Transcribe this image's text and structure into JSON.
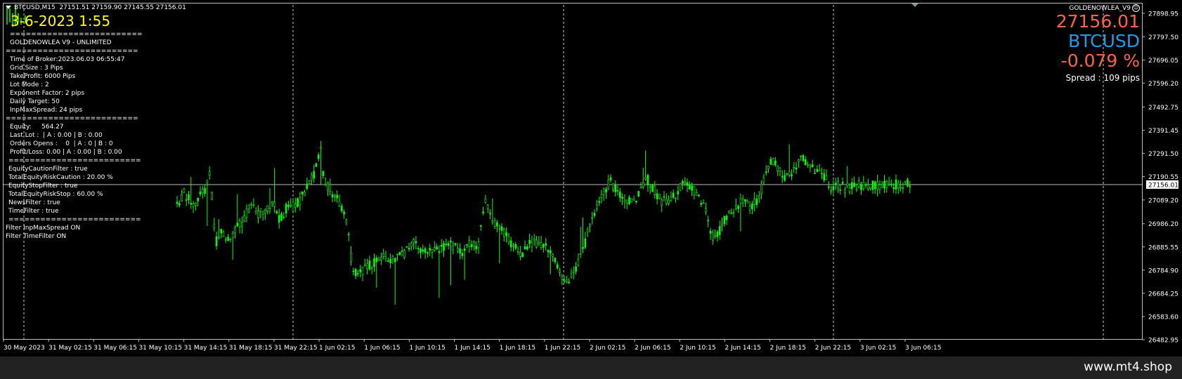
{
  "window": {
    "symbol_bar": "BTCUSD,M15  27151.51 27159.90 27145.55 27156.01",
    "datetime_overlay": "3-6-2023 1:55"
  },
  "ea_panel": {
    "sep": "=========================",
    "title": "GOLDENOWLEA V9 - UNLIMITED",
    "broker_time": "Time of Broker:2023.06.03 06:55:47",
    "grid_size": "Grid Size : 3 Pips",
    "take_profit": "TakeProfit: 6000 Pips",
    "lot_mode": "Lot Mode : 2",
    "exponent_factor": "Exponent Factor: 2 pips",
    "daily_target": "Daily Target: 50",
    "inp_max_spread": "InpMaxSpread: 24 pips",
    "equity": "Equity:     564.27",
    "last_lot": "Last Lot :  | A : 0.00 | B : 0.00",
    "orders_opens": "Orders Opens :    0  | A : 0 | B : 0",
    "profit_loss": "Profit/Loss: 0.00 | A : 0.00 | B : 0.00",
    "equity_caution_filter": "EquityCautionFilter : true",
    "total_equity_risk_caution": "TotalEquityRiskCaution : 20.00 %",
    "equity_stop_filter": "EquityStopFilter : true",
    "total_equity_risk_stop": "TotalEquityRiskStop : 60.00 %",
    "news_filter": "NewsFilter : true",
    "time_filter": "TimeFilter : true",
    "filter_spread_status": "Filter InpMaxSpread ON",
    "filter_time_status": "Filter TimeFilter ON"
  },
  "right_panel": {
    "ea_name": "GOLDENOWLEA_V9",
    "price": "27156.01",
    "symbol": "BTCUSD",
    "change": "-0.079 %",
    "spread": "Spread : 109 pips"
  },
  "footer": {
    "watermark": "www.mt4.shop"
  },
  "colors": {
    "background": "#000000",
    "candles": "#00ff00",
    "grid": "#c8c8c8",
    "text": "#ffffff",
    "datetime": "#ffff00",
    "price_red": "#ff6347",
    "symbol_blue": "#1e9ee6"
  },
  "chart_data": {
    "type": "candlestick",
    "symbol": "BTCUSD",
    "timeframe": "M15",
    "ohlc_last": {
      "open": 27151.51,
      "high": 27159.9,
      "low": 27145.55,
      "close": 27156.01
    },
    "current_price": 27156.01,
    "current_price_label": "27156.01",
    "y_ticks": [
      "27898.95",
      "27797.50",
      "27696.05",
      "27596.20",
      "27492.75",
      "27391.45",
      "27291.50",
      "27190.55",
      "27089.20",
      "26986.20",
      "26885.55",
      "26784.90",
      "26684.25",
      "26583.60",
      "26482.95"
    ],
    "x_ticks": [
      "30 May 2023",
      "31 May 02:15",
      "31 May 06:15",
      "31 May 10:15",
      "31 May 14:15",
      "31 May 18:15",
      "31 May 22:15",
      "1 Jun 02:15",
      "1 Jun 06:15",
      "1 Jun 10:15",
      "1 Jun 14:15",
      "1 Jun 18:15",
      "1 Jun 22:15",
      "2 Jun 02:15",
      "2 Jun 06:15",
      "2 Jun 10:15",
      "2 Jun 14:15",
      "2 Jun 18:15",
      "2 Jun 22:15",
      "3 Jun 02:15",
      "3 Jun 06:15"
    ],
    "ylim": [
      26450,
      27950
    ],
    "grid": "vertical day separators",
    "price_path": [
      [
        0.0,
        27070
      ],
      [
        0.01,
        27120
      ],
      [
        0.02,
        27075
      ],
      [
        0.03,
        27100
      ],
      [
        0.04,
        27140
      ],
      [
        0.045,
        27210
      ],
      [
        0.05,
        27000
      ],
      [
        0.055,
        26880
      ],
      [
        0.06,
        26960
      ],
      [
        0.07,
        26920
      ],
      [
        0.08,
        26960
      ],
      [
        0.09,
        27000
      ],
      [
        0.1,
        27060
      ],
      [
        0.11,
        27030
      ],
      [
        0.12,
        27040
      ],
      [
        0.13,
        27080
      ],
      [
        0.14,
        27000
      ],
      [
        0.15,
        27060
      ],
      [
        0.16,
        27060
      ],
      [
        0.17,
        27100
      ],
      [
        0.18,
        27160
      ],
      [
        0.19,
        27230
      ],
      [
        0.195,
        27340
      ],
      [
        0.2,
        27180
      ],
      [
        0.21,
        27130
      ],
      [
        0.22,
        27080
      ],
      [
        0.23,
        27020
      ],
      [
        0.24,
        26760
      ],
      [
        0.25,
        26780
      ],
      [
        0.26,
        26800
      ],
      [
        0.27,
        26820
      ],
      [
        0.28,
        26840
      ],
      [
        0.29,
        26820
      ],
      [
        0.3,
        26840
      ],
      [
        0.31,
        26860
      ],
      [
        0.32,
        26900
      ],
      [
        0.33,
        26880
      ],
      [
        0.34,
        26880
      ],
      [
        0.35,
        26860
      ],
      [
        0.36,
        26880
      ],
      [
        0.37,
        26900
      ],
      [
        0.38,
        26880
      ],
      [
        0.39,
        26860
      ],
      [
        0.4,
        26900
      ],
      [
        0.41,
        26880
      ],
      [
        0.42,
        27100
      ],
      [
        0.43,
        26980
      ],
      [
        0.44,
        26980
      ],
      [
        0.45,
        26920
      ],
      [
        0.46,
        26880
      ],
      [
        0.47,
        26860
      ],
      [
        0.48,
        26900
      ],
      [
        0.49,
        26900
      ],
      [
        0.5,
        26900
      ],
      [
        0.51,
        26860
      ],
      [
        0.52,
        26800
      ],
      [
        0.53,
        26720
      ],
      [
        0.54,
        26780
      ],
      [
        0.55,
        26840
      ],
      [
        0.56,
        26950
      ],
      [
        0.57,
        27040
      ],
      [
        0.58,
        27120
      ],
      [
        0.59,
        27170
      ],
      [
        0.6,
        27130
      ],
      [
        0.61,
        27100
      ],
      [
        0.62,
        27080
      ],
      [
        0.63,
        27120
      ],
      [
        0.64,
        27180
      ],
      [
        0.65,
        27130
      ],
      [
        0.66,
        27080
      ],
      [
        0.67,
        27090
      ],
      [
        0.68,
        27120
      ],
      [
        0.69,
        27160
      ],
      [
        0.7,
        27150
      ],
      [
        0.71,
        27110
      ],
      [
        0.72,
        27040
      ],
      [
        0.73,
        26920
      ],
      [
        0.74,
        26960
      ],
      [
        0.75,
        27030
      ],
      [
        0.76,
        27060
      ],
      [
        0.77,
        27080
      ],
      [
        0.78,
        27060
      ],
      [
        0.79,
        27080
      ],
      [
        0.8,
        27180
      ],
      [
        0.81,
        27260
      ],
      [
        0.82,
        27210
      ],
      [
        0.83,
        27180
      ],
      [
        0.84,
        27210
      ],
      [
        0.85,
        27270
      ],
      [
        0.86,
        27240
      ],
      [
        0.87,
        27220
      ],
      [
        0.88,
        27190
      ],
      [
        0.89,
        27150
      ],
      [
        0.9,
        27160
      ],
      [
        0.91,
        27140
      ],
      [
        0.92,
        27150
      ],
      [
        0.93,
        27155
      ],
      [
        0.94,
        27150
      ],
      [
        0.95,
        27156.01
      ]
    ]
  }
}
